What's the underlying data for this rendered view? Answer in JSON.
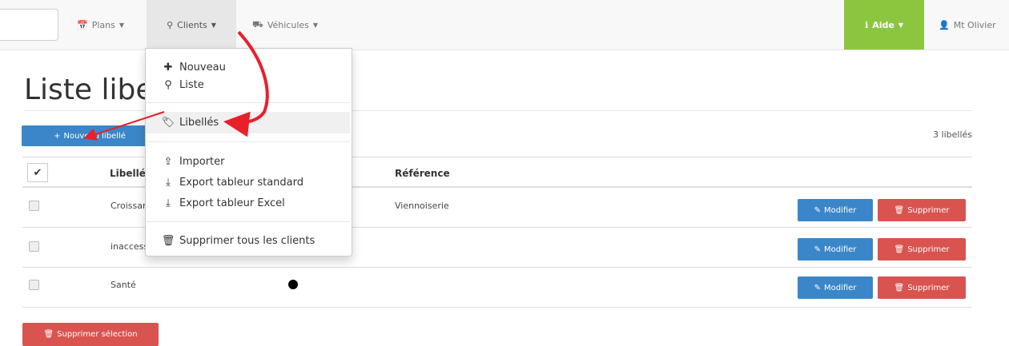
{
  "navbar": {
    "plans": "Plans",
    "clients": "Clients",
    "vehicules": "Véhicules",
    "aide": "Aide",
    "user": "Mt Olivier"
  },
  "dropdown": {
    "items": [
      {
        "label": "Nouveau",
        "icon": "plus-icon"
      },
      {
        "label": "Liste",
        "icon": "map-marker-icon"
      },
      {
        "label": "Libellés",
        "icon": "tags-icon"
      },
      {
        "label": "Importer",
        "icon": "upload-icon"
      },
      {
        "label": "Export tableur standard",
        "icon": "download-icon"
      },
      {
        "label": "Export tableur Excel",
        "icon": "download-icon"
      },
      {
        "label": "Supprimer tous les clients",
        "icon": "trash-icon"
      }
    ]
  },
  "page": {
    "title": "Liste libellés",
    "new_button": "Nouveau libellé",
    "count": "3 libellés",
    "bulk_delete": "Supprimer sélection"
  },
  "table": {
    "headers": [
      "Libellé",
      "Référence"
    ],
    "rows": [
      {
        "label": "Croissant",
        "reference": "Viennoiserie"
      },
      {
        "label": "inaccessible",
        "reference": ""
      },
      {
        "label": "Santé",
        "reference": ""
      }
    ],
    "modify_label": "Modifier",
    "delete_label": "Supprimer"
  },
  "colors": {
    "primary": "#3a86c8",
    "danger": "#d9534f",
    "aide": "#8cc63f",
    "annotation_arrow": "#e8202a"
  }
}
